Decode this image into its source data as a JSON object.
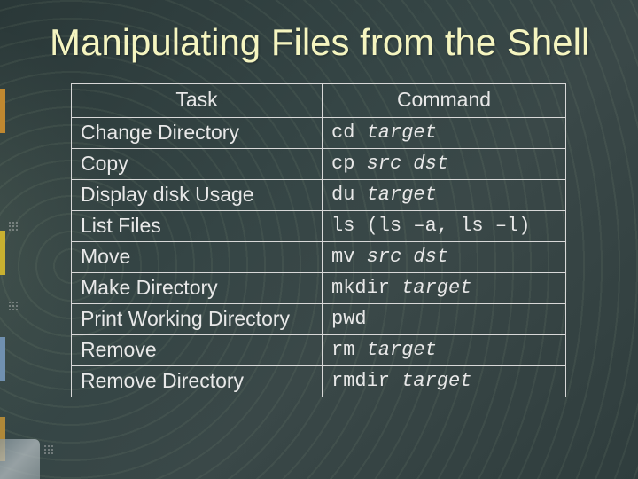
{
  "title": "Manipulating Files from the Shell",
  "headers": {
    "task": "Task",
    "command": "Command"
  },
  "rows": [
    {
      "task": "Change Directory",
      "cmd": "cd",
      "arg": "target",
      "tail": ""
    },
    {
      "task": "Copy",
      "cmd": "cp",
      "arg": "src dst",
      "tail": ""
    },
    {
      "task": "Display disk Usage",
      "cmd": "du",
      "arg": "target",
      "tail": ""
    },
    {
      "task": "List Files",
      "cmd": "ls",
      "arg": "",
      "tail": "(ls –a, ls –l)"
    },
    {
      "task": "Move",
      "cmd": "mv",
      "arg": "src dst",
      "tail": ""
    },
    {
      "task": "Make Directory",
      "cmd": "mkdir",
      "arg": "target",
      "tail": ""
    },
    {
      "task": "Print Working Directory",
      "cmd": "pwd",
      "arg": "",
      "tail": ""
    },
    {
      "task": "Remove",
      "cmd": "rm",
      "arg": "target",
      "tail": ""
    },
    {
      "task": "Remove Directory",
      "cmd": "rmdir",
      "arg": "target",
      "tail": ""
    }
  ]
}
